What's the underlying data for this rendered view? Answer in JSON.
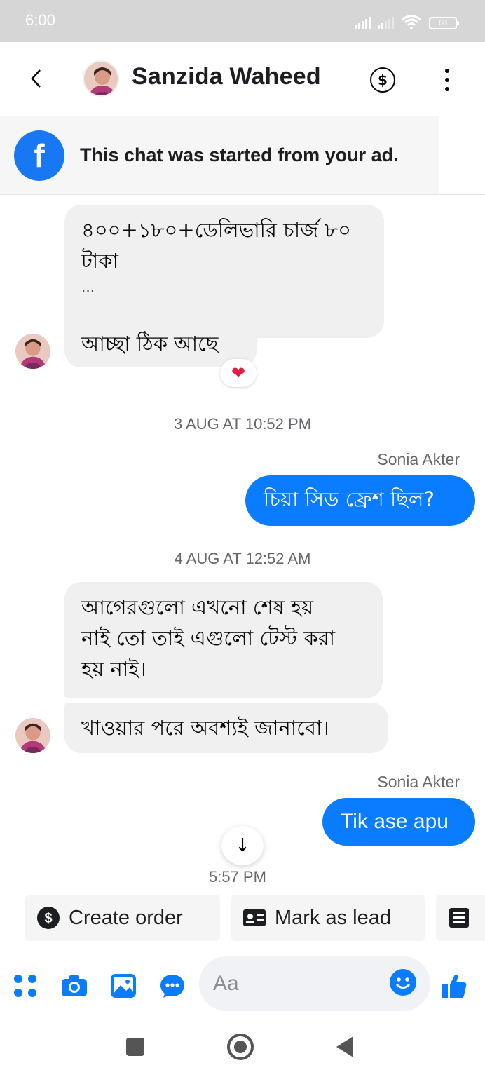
{
  "status_bar": {
    "time": "6:00",
    "battery": "68"
  },
  "header": {
    "back_icon": "chevron-left-icon",
    "contact_name": "Sanzida Waheed",
    "payment_icon": "dollar-circle-icon",
    "more_icon": "vertical-dots-icon"
  },
  "ad_banner": {
    "icon": "facebook-icon",
    "text": "This chat was started from your ad."
  },
  "messages": {
    "m1_line1": "৪০০+১৮০+ডেলিভারি চার্জ ৮০",
    "m1_line2": "টাকা",
    "m1_line3": "...",
    "m2": "আচ্ছা ঠিক আছে",
    "m2_reaction": "❤",
    "ts1": "3 AUG AT 10:52 PM",
    "sender1": "Sonia Akter",
    "m3": "চিয়া সিড ফ্রেশ ছিল?",
    "ts2": "4 AUG AT 12:52 AM",
    "m4_line1": "আগেরগুলো এখনো শেষ হয়",
    "m4_line2": "নাই তো তাই এগুলো টেস্ট করা",
    "m4_line3": "হয় নাই।",
    "m5": "খাওয়ার পরে অবশ্যই জানাবো।",
    "sender2": "Sonia Akter",
    "m6": "Tik ase apu",
    "last_time": "5:57 PM"
  },
  "quick_actions": {
    "create_order": "Create order",
    "mark_as_lead": "Mark as lead"
  },
  "composer": {
    "placeholder": "Aa",
    "accent": "#0a7cff"
  },
  "colors": {
    "outgoing_bubble": "#0a7cff",
    "incoming_bubble": "#f0f0f0",
    "facebook_blue": "#1877f2"
  }
}
